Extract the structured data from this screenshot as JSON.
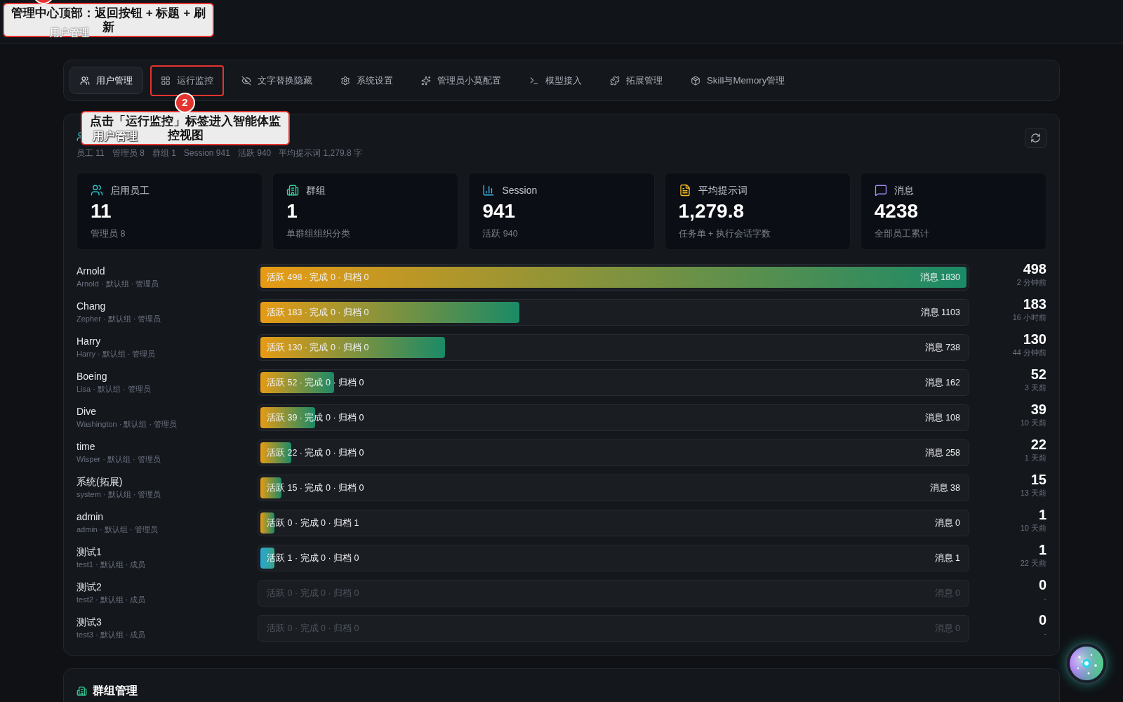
{
  "header": {
    "title": "用户管理"
  },
  "tabs": [
    {
      "label": "用户管理",
      "selected": true,
      "highlighted": false
    },
    {
      "label": "运行监控",
      "selected": false,
      "highlighted": true
    },
    {
      "label": "文字替换隐藏",
      "selected": false,
      "highlighted": false
    },
    {
      "label": "系统设置",
      "selected": false,
      "highlighted": false
    },
    {
      "label": "管理员小莫配置",
      "selected": false,
      "highlighted": false
    },
    {
      "label": "模型接入",
      "selected": false,
      "highlighted": false
    },
    {
      "label": "拓展管理",
      "selected": false,
      "highlighted": false
    },
    {
      "label": "Skill与Memory管理",
      "selected": false,
      "highlighted": false
    }
  ],
  "user_section": {
    "title": "用户管理",
    "summary": [
      "员工 11",
      "管理员 8",
      "群组 1",
      "Session 941",
      "活跃 940",
      "平均提示词 1,279.8 字"
    ],
    "stats": [
      {
        "label": "启用员工",
        "value": "11",
        "note": "管理员 8"
      },
      {
        "label": "群组",
        "value": "1",
        "note": "单群组组织分类"
      },
      {
        "label": "Session",
        "value": "941",
        "note": "活跃 940"
      },
      {
        "label": "平均提示词",
        "value": "1,279.8",
        "note": "任务单 + 执行会话字数"
      },
      {
        "label": "消息",
        "value": "4238",
        "note": "全部员工累计"
      }
    ],
    "rows": [
      {
        "name": "Arnold",
        "detail": "Arnold · 默认组 · 管理员",
        "kind": "warm",
        "level": 1,
        "stats": "活跃 498 · 完成 0 · 归档 0",
        "messages": "消息 1830",
        "count": "498",
        "last_active": "2 分钟前"
      },
      {
        "name": "Chang",
        "detail": "Zepher · 默认组 · 管理员",
        "kind": "warm",
        "level": 0.367,
        "stats": "活跃 183 · 完成 0 · 归档 0",
        "messages": "消息 1103",
        "count": "183",
        "last_active": "16 小时前"
      },
      {
        "name": "Harry",
        "detail": "Harry · 默认组 · 管理员",
        "kind": "warm",
        "level": 0.261,
        "stats": "活跃 130 · 完成 0 · 归档 0",
        "messages": "消息 738",
        "count": "130",
        "last_active": "44 分钟前"
      },
      {
        "name": "Boeing",
        "detail": "Lisa · 默认组 · 管理员",
        "kind": "warm",
        "level": 0.104,
        "stats": "活跃 52 · 完成 0 · 归档 0",
        "messages": "消息 162",
        "count": "52",
        "last_active": "3 天前"
      },
      {
        "name": "Dive",
        "detail": "Washington · 默认组 · 管理员",
        "kind": "warm",
        "level": 0.078,
        "stats": "活跃 39 · 完成 0 · 归档 0",
        "messages": "消息 108",
        "count": "39",
        "last_active": "10 天前"
      },
      {
        "name": "time",
        "detail": "Wisper · 默认组 · 管理员",
        "kind": "warm",
        "level": 0.044,
        "stats": "活跃 22 · 完成 0 · 归档 0",
        "messages": "消息 258",
        "count": "22",
        "last_active": "1 天前"
      },
      {
        "name": "系统(拓展)",
        "detail": "system · 默认组 · 管理员",
        "kind": "warm",
        "level": 0.03,
        "stats": "活跃 15 · 完成 0 · 归档 0",
        "messages": "消息 38",
        "count": "15",
        "last_active": "13 天前"
      },
      {
        "name": "admin",
        "detail": "admin · 默认组 · 管理员",
        "kind": "warm",
        "level": 0.02,
        "stats": "活跃 0 · 完成 0 · 归档 1",
        "messages": "消息 0",
        "count": "1",
        "last_active": "10 天前"
      },
      {
        "name": "测试1",
        "detail": "test1 · 默认组 · 成员",
        "kind": "cool",
        "level": 0.02,
        "stats": "活跃 1 · 完成 0 · 归档 0",
        "messages": "消息 1",
        "count": "1",
        "last_active": "22 天前"
      },
      {
        "name": "测试2",
        "detail": "test2 · 默认组 · 成员",
        "kind": "empty",
        "stats": "活跃 0 · 完成 0 · 归档 0",
        "messages": "消息 0",
        "count": "0",
        "last_active": "-"
      },
      {
        "name": "测试3",
        "detail": "test3 · 默认组 · 成员",
        "kind": "empty",
        "stats": "活跃 0 · 完成 0 · 归档 0",
        "messages": "消息 0",
        "count": "0",
        "last_active": "-"
      }
    ]
  },
  "group_section": {
    "title": "群组管理"
  },
  "callouts": [
    {
      "text": "管理中心顶部：返回按钮 + 标题 + 刷新",
      "badge": {
        "kind": "cut"
      }
    },
    {
      "text": "点击「运行监控」标签进入智能体监控视图",
      "badge": {
        "kind": "full",
        "label": "2"
      }
    }
  ]
}
